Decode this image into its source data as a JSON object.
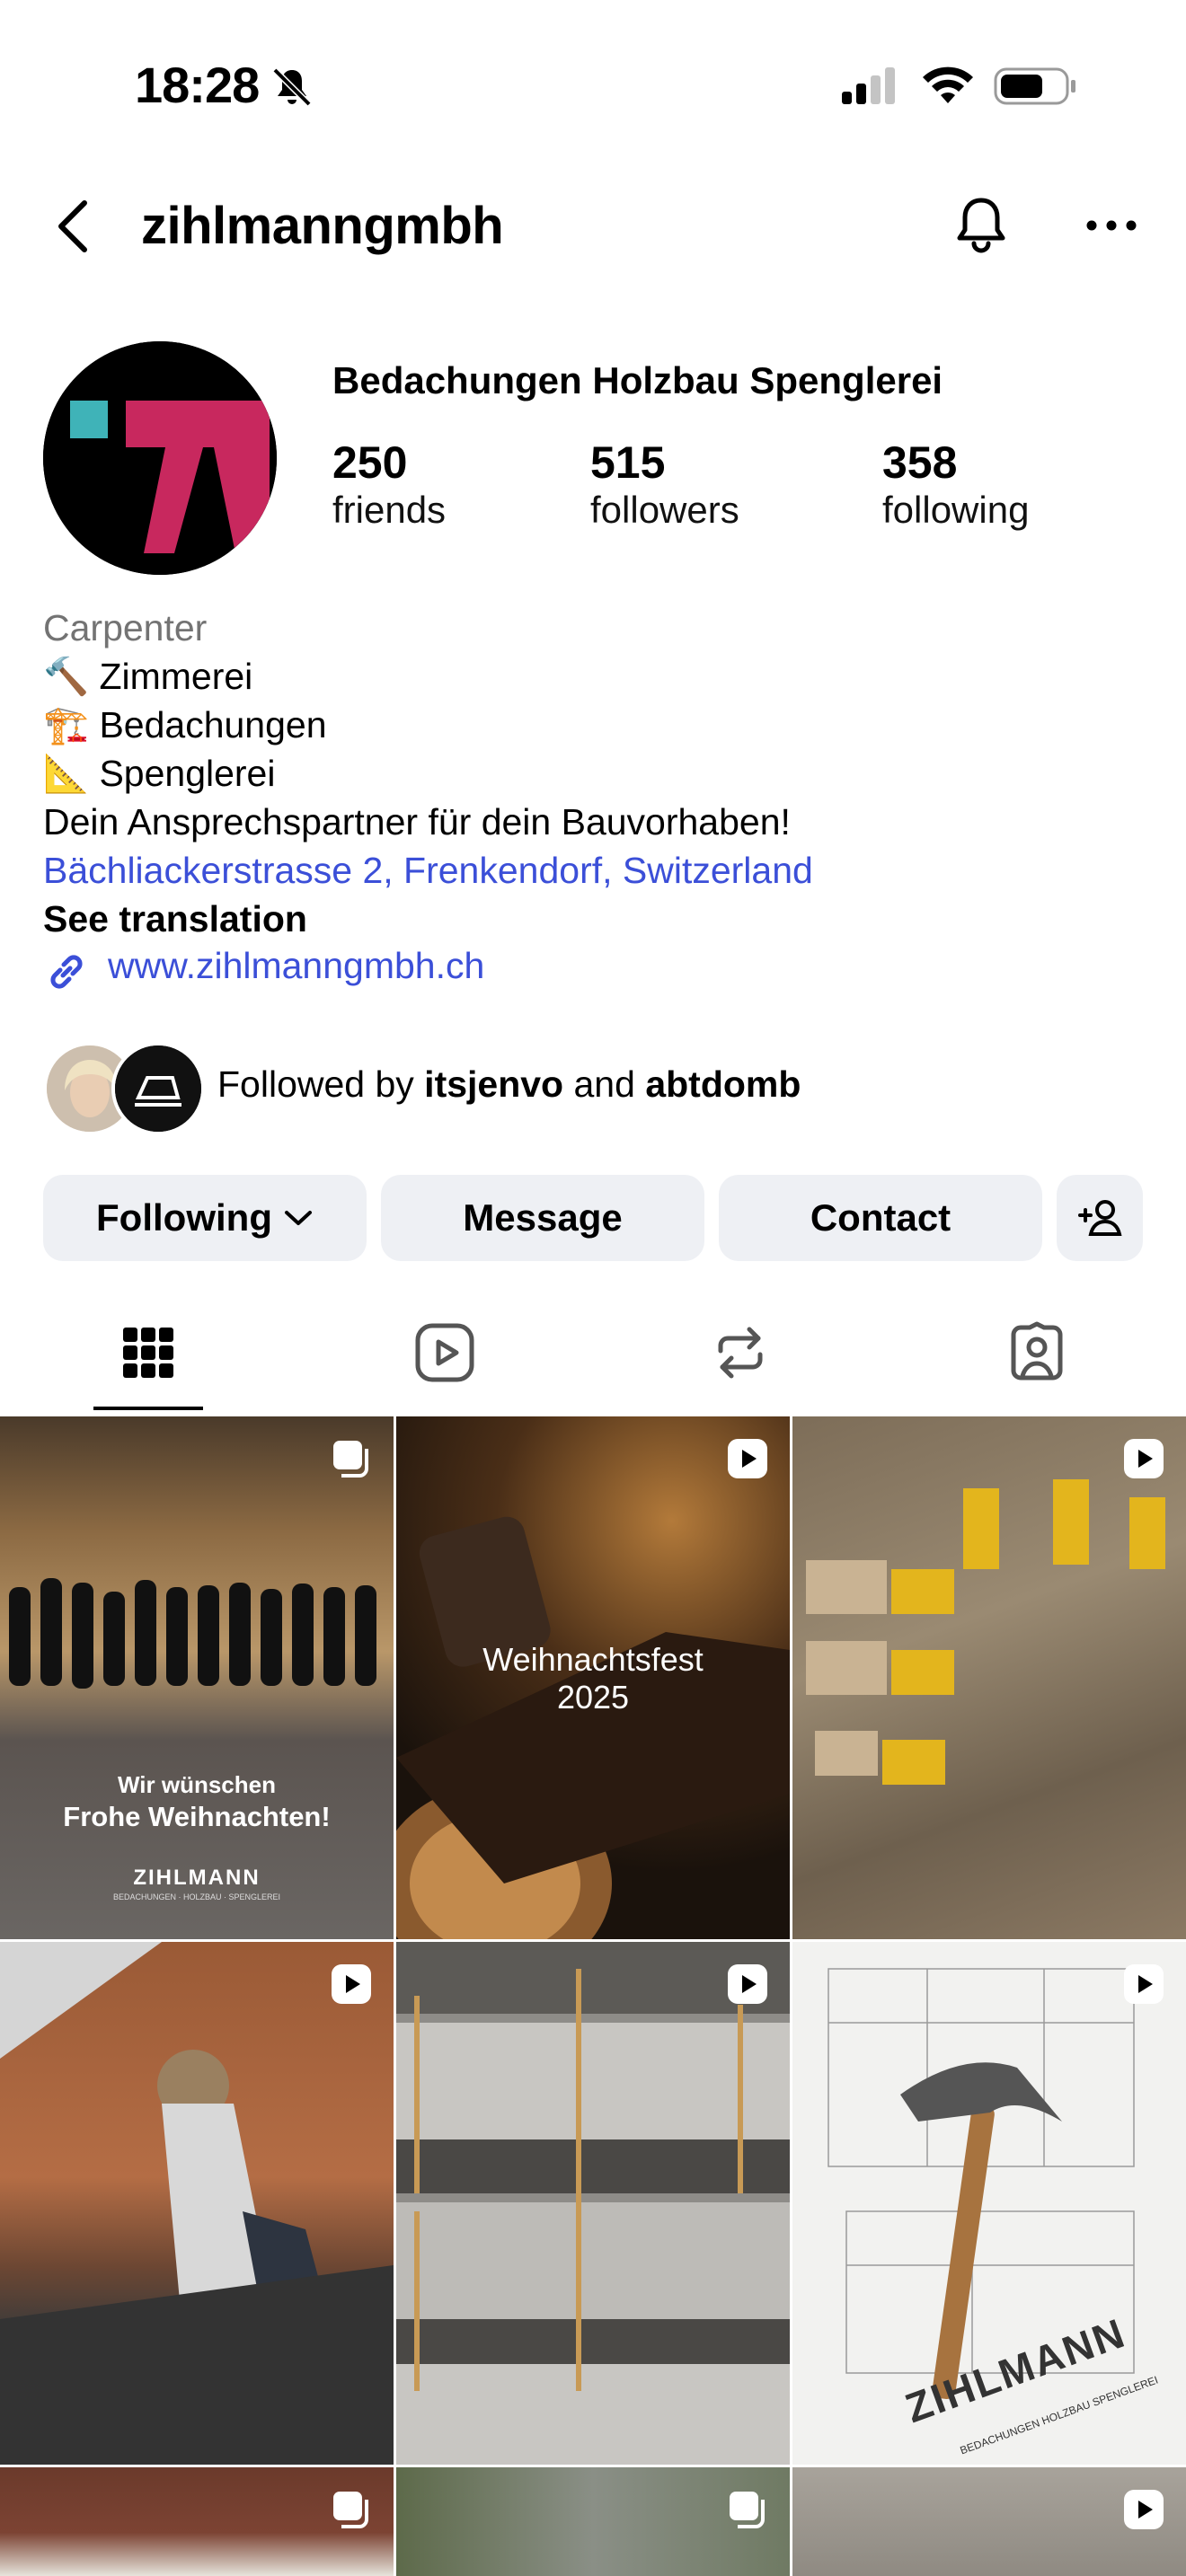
{
  "status_bar": {
    "time": "18:28",
    "icons": [
      "bell-muted-icon",
      "signal-icon",
      "wifi-icon",
      "battery-icon"
    ]
  },
  "nav": {
    "username": "zihlmanngmbh",
    "icons": [
      "back-icon",
      "notification-bell-icon",
      "more-icon"
    ]
  },
  "profile": {
    "display_name": "Bedachungen Holzbau Spenglerei",
    "stats": [
      {
        "value": "250",
        "label": "friends"
      },
      {
        "value": "515",
        "label": "followers"
      },
      {
        "value": "358",
        "label": "following"
      }
    ]
  },
  "bio": {
    "category": "Carpenter",
    "lines": [
      "🔨 Zimmerei",
      "🏗️ Bedachungen",
      "📐 Spenglerei",
      "Dein Ansprechspartner für dein Bauvorhaben!"
    ],
    "address": "Bächliackerstrasse 2, Frenkendorf, Switzerland",
    "see_translation": "See translation",
    "website": "www.zihlmanngmbh.ch"
  },
  "followed_by": {
    "prefix": "Followed by ",
    "user1": "itsjenvo",
    "and": " and ",
    "user2": "abtdomb"
  },
  "buttons": {
    "following": "Following",
    "message": "Message",
    "contact": "Contact"
  },
  "tabs": [
    "grid-icon",
    "reels-icon",
    "reposts-icon",
    "tagged-icon"
  ],
  "posts": {
    "post1_line1": "Wir wünschen",
    "post1_line2": "Frohe Weihnachten!",
    "post1_brand": "ZIHLMANN",
    "post1_sub": "BEDACHUNGEN · HOLZBAU · SPENGLEREI",
    "post2_line1": "Weihnachtsfest",
    "post2_line2": "2025",
    "post6_brand": "ZIHLMANN",
    "post6_sub": "BEDACHUNGEN  HOLZBAU  SPENGLEREI"
  },
  "colors": {
    "brand_magenta": "#c8285e",
    "brand_teal": "#3fb3b8",
    "link_blue": "#3b4fd8",
    "button_bg": "#eef0f4"
  }
}
